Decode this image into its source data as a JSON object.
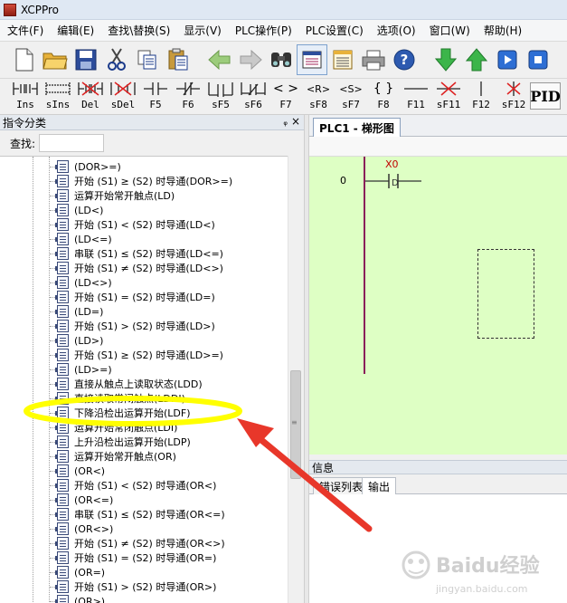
{
  "window": {
    "title": "XCPPro"
  },
  "menu": [
    "文件(F)",
    "编辑(E)",
    "查找\\替换(S)",
    "显示(V)",
    "PLC操作(P)",
    "PLC设置(C)",
    "选项(O)",
    "窗口(W)",
    "帮助(H)"
  ],
  "toolbar_icons": [
    "new-file-icon",
    "open-folder-icon",
    "save-icon",
    "cut-icon",
    "copy-icon",
    "paste-icon",
    "back-arrow-icon",
    "forward-arrow-icon",
    "find-icon",
    "ladder-view-icon",
    "list-view-icon",
    "print-icon",
    "help-icon",
    "download-icon",
    "upload-icon",
    "run-icon",
    "stop-icon"
  ],
  "ladder_toolbar": [
    {
      "label": "Ins"
    },
    {
      "label": "sIns"
    },
    {
      "label": "Del"
    },
    {
      "label": "sDel"
    },
    {
      "label": "F5"
    },
    {
      "label": "F6"
    },
    {
      "label": "sF5"
    },
    {
      "label": "sF6"
    },
    {
      "label": "F7"
    },
    {
      "label": "sF8"
    },
    {
      "label": "sF7"
    },
    {
      "label": "F8"
    },
    {
      "label": "F11"
    },
    {
      "label": "sF11"
    },
    {
      "label": "F12"
    },
    {
      "label": "sF12"
    }
  ],
  "ladder_symbols": {
    "f7": "< >",
    "sf8": "<R>",
    "sf7": "<S>",
    "f8": "{ }",
    "pid": "PID"
  },
  "left_panel": {
    "title": "指令分类",
    "pin": "ᵩ",
    "close": "×",
    "search_label": "查找:",
    "search_value": "",
    "items": [
      "(DOR>=)",
      "开始 (S1) ≥ (S2) 时导通(DOR>=)",
      "运算开始常开触点(LD)",
      "(LD<)",
      "开始 (S1) < (S2) 时导通(LD<)",
      "(LD<=)",
      "串联 (S1) ≤ (S2) 时导通(LD<=)",
      "开始 (S1) ≠ (S2) 时导通(LD<>)",
      "(LD<>)",
      "开始 (S1) = (S2) 时导通(LD=)",
      "(LD=)",
      "开始 (S1) > (S2) 时导通(LD>)",
      "(LD>)",
      "开始 (S1) ≥ (S2) 时导通(LD>=)",
      "(LD>=)",
      "直接从触点上读取状态(LDD)",
      "直接读取常闭触点(LDDI)",
      "下降沿检出运算开始(LDF)",
      "运算开始常闭触点(LDI)",
      "上升沿检出运算开始(LDP)",
      "运算开始常开触点(OR)",
      "(OR<)",
      "开始 (S1) < (S2) 时导通(OR<)",
      "(OR<=)",
      "串联 (S1) ≤ (S2) 时导通(OR<=)",
      "(OR<>)",
      "开始 (S1) ≠ (S2) 时导通(OR<>)",
      "开始 (S1) = (S2) 时导通(OR=)",
      "(OR=)",
      "开始 (S1) > (S2) 时导通(OR>)",
      "(OR>)"
    ]
  },
  "editor": {
    "tab_label": "PLC1 - 梯形图",
    "rung_number": "0",
    "contact_address": "X0",
    "contact_type": "D"
  },
  "info_panel": {
    "title": "信息",
    "tabs": [
      "错误列表",
      "输出"
    ]
  },
  "watermark": {
    "text": "Baidu经验",
    "subtext": "jingyan.baidu.com"
  },
  "colors": {
    "ladder_background": "#deffc4",
    "power_rail": "#8a1f5a",
    "contact_label": "#c00000",
    "highlight_ellipse": "#ffff00",
    "annotation_arrow": "#e8372a"
  }
}
